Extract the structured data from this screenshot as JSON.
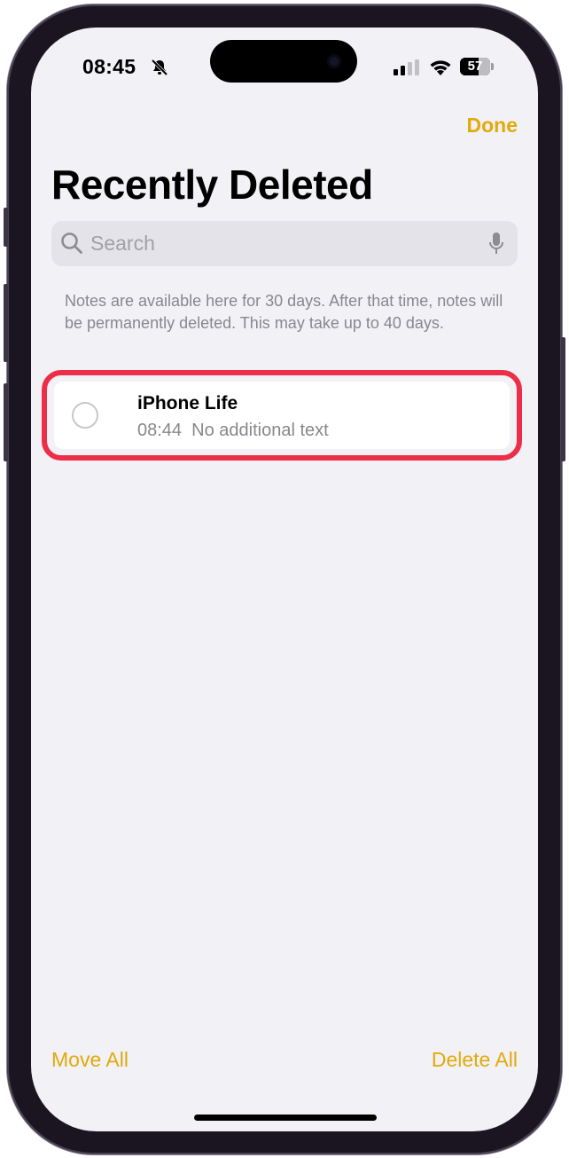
{
  "status_bar": {
    "time": "08:45",
    "silent_icon": "bell-slash-icon",
    "signal_icon": "cellular-signal-icon",
    "wifi_icon": "wifi-icon",
    "battery_percent": "57"
  },
  "header": {
    "done_label": "Done",
    "title": "Recently Deleted"
  },
  "search": {
    "placeholder": "Search",
    "value": "",
    "search_icon": "magnifying-glass-icon",
    "mic_icon": "microphone-icon"
  },
  "info": {
    "text": "Notes are available here for 30 days. After that time, notes will be permanently deleted. This may take up to 40 days."
  },
  "notes": [
    {
      "title": "iPhone Life",
      "meta": "08:44  No additional text",
      "selected": false
    }
  ],
  "toolbar": {
    "move_all_label": "Move All",
    "delete_all_label": "Delete All"
  },
  "colors": {
    "accent": "#e2aa0b",
    "highlight": "#ed2e49",
    "background": "#f2f1f6"
  }
}
